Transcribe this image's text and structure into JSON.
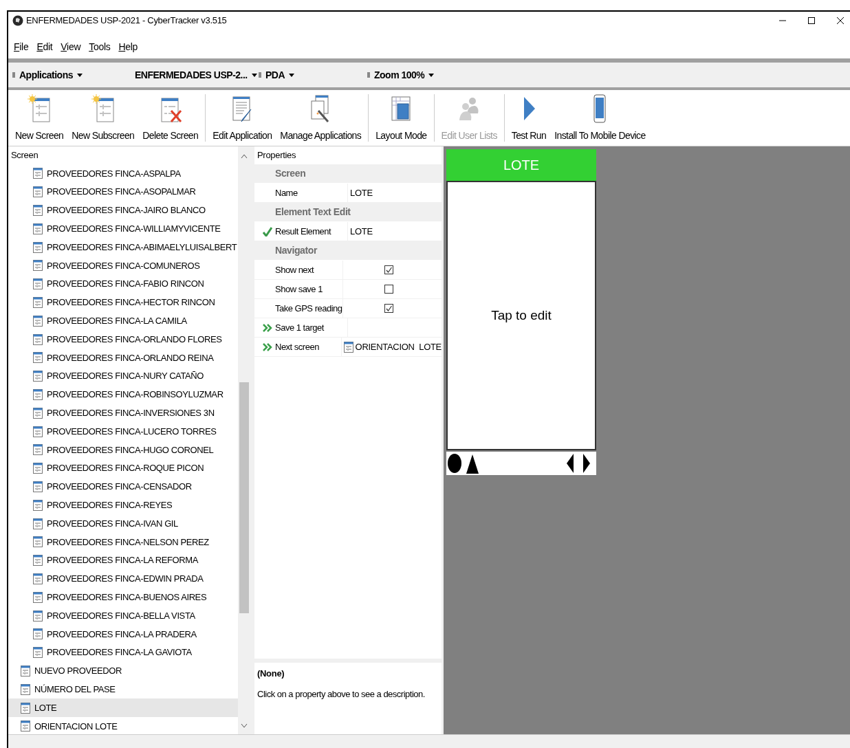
{
  "window": {
    "title": "ENFERMEDADES USP-2021 - CyberTracker v3.515"
  },
  "menu": [
    "File",
    "Edit",
    "View",
    "Tools",
    "Help"
  ],
  "selectors": [
    {
      "label": "Applications"
    },
    {
      "label": "ENFERMEDADES USP-2..."
    },
    {
      "label": "PDA"
    },
    {
      "label": "Zoom 100%"
    }
  ],
  "toolbar": [
    {
      "label": "New Screen",
      "disabled": false
    },
    {
      "label": "New Subscreen",
      "disabled": false
    },
    {
      "label": "Delete Screen",
      "disabled": false
    },
    {
      "label": "Edit Application",
      "disabled": false
    },
    {
      "label": "Manage Applications",
      "disabled": false
    },
    {
      "label": "Layout Mode",
      "disabled": false
    },
    {
      "label": "Edit User Lists",
      "disabled": true
    },
    {
      "label": "Test Run",
      "disabled": false
    },
    {
      "label": "Install To Mobile Device",
      "disabled": false
    }
  ],
  "tree": {
    "header": "Screen",
    "items": [
      {
        "children": [
          {
            "label": "PROVEEDORES FINCA-ASPALPA",
            "selected": false
          },
          {
            "label": "PROVEEDORES FINCA-ASOPALMAR",
            "selected": false
          },
          {
            "label": "PROVEEDORES FINCA-JAIRO BLANCO",
            "selected": false
          },
          {
            "label": "PROVEEDORES FINCA-WILLIAMYVICENTE",
            "selected": false
          },
          {
            "label": "PROVEEDORES FINCA-ABIMAELYLUISALBERT",
            "selected": false
          },
          {
            "label": "PROVEEDORES FINCA-COMUNEROS",
            "selected": false
          },
          {
            "label": "PROVEEDORES FINCA-FABIO RINCON",
            "selected": false
          },
          {
            "label": "PROVEEDORES FINCA-HECTOR RINCON",
            "selected": false
          },
          {
            "label": "PROVEEDORES FINCA-LA CAMILA",
            "selected": false
          },
          {
            "label": "PROVEEDORES FINCA-ORLANDO FLORES",
            "selected": false
          },
          {
            "label": "PROVEEDORES FINCA-ORLANDO REINA",
            "selected": false
          },
          {
            "label": "PROVEEDORES FINCA-NURY CATAÑO",
            "selected": false
          },
          {
            "label": "PROVEEDORES FINCA-ROBINSOYLUZMAR",
            "selected": false
          },
          {
            "label": "PROVEEDORES FINCA-INVERSIONES 3N",
            "selected": false
          },
          {
            "label": "PROVEEDORES FINCA-LUCERO TORRES",
            "selected": false
          },
          {
            "label": "PROVEEDORES FINCA-HUGO CORONEL",
            "selected": false
          },
          {
            "label": "PROVEEDORES FINCA-ROQUE PICON",
            "selected": false
          },
          {
            "label": "PROVEEDORES FINCA-CENSADOR",
            "selected": false
          },
          {
            "label": "PROVEEDORES FINCA-REYES",
            "selected": false
          },
          {
            "label": "PROVEEDORES FINCA-IVAN GIL",
            "selected": false
          },
          {
            "label": "PROVEEDORES FINCA-NELSON PEREZ",
            "selected": false
          },
          {
            "label": "PROVEEDORES FINCA-LA REFORMA",
            "selected": false
          },
          {
            "label": "PROVEEDORES FINCA-EDWIN PRADA",
            "selected": false
          },
          {
            "label": "PROVEEDORES FINCA-BUENOS AIRES",
            "selected": false
          },
          {
            "label": "PROVEEDORES FINCA-BELLA VISTA",
            "selected": false
          },
          {
            "label": "PROVEEDORES FINCA-LA PRADERA",
            "selected": false
          },
          {
            "label": "PROVEEDORES FINCA-LA GAVIOTA",
            "selected": false
          }
        ]
      },
      {
        "label": "NUEVO PROVEEDOR",
        "selected": false
      },
      {
        "label": "NÚMERO DEL PASE",
        "selected": false
      },
      {
        "label": "LOTE",
        "selected": true
      },
      {
        "label": "ORIENTACION  LOTE",
        "selected": false
      }
    ]
  },
  "properties": {
    "header": "Properties",
    "rows": [
      {
        "kind": "category",
        "label": "Screen"
      },
      {
        "kind": "text",
        "label": "Name",
        "value": "LOTE"
      },
      {
        "kind": "category",
        "label": "Element Text Edit"
      },
      {
        "kind": "result",
        "label": "Result Element",
        "value": "LOTE"
      },
      {
        "kind": "category",
        "label": "Navigator"
      },
      {
        "kind": "checkbox",
        "label": "Show next",
        "checked": true
      },
      {
        "kind": "checkbox",
        "label": "Show save 1",
        "checked": false
      },
      {
        "kind": "checkbox",
        "label": "Take GPS reading",
        "checked": true
      },
      {
        "kind": "link",
        "label": "Save 1 target"
      },
      {
        "kind": "link",
        "label": "Next screen",
        "value": "ORIENTACION  LOTE"
      }
    ],
    "description": {
      "title": "(None)",
      "text": "Click on a property above to see a description."
    }
  },
  "preview": {
    "title": "LOTE",
    "body": "Tap to edit"
  }
}
